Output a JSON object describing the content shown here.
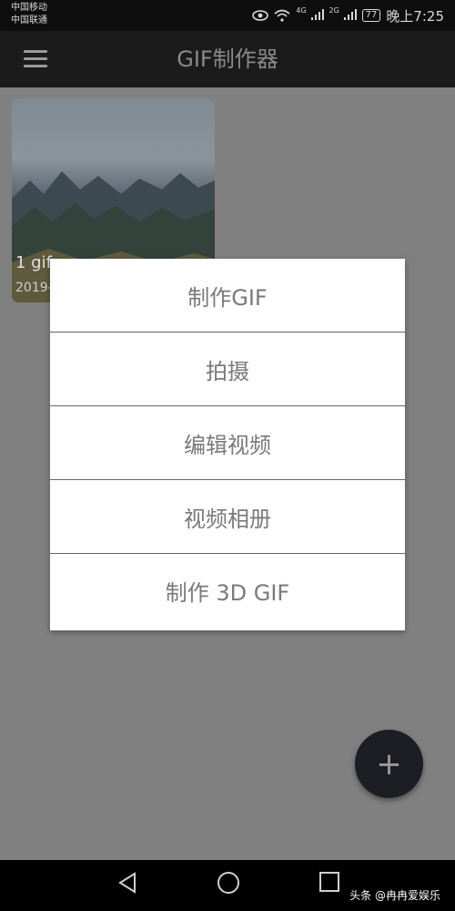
{
  "status_bar": {
    "carrier_1": "中国移动",
    "carrier_2": "中国联通",
    "network_1": "4G",
    "network_2": "2G",
    "battery": "77",
    "time": "晚上7:25"
  },
  "app_bar": {
    "title": "GIF制作器",
    "menu_icon": "hamburger-menu-icon"
  },
  "gallery": {
    "items": [
      {
        "name": "1 gif",
        "date": "2019-"
      }
    ]
  },
  "dialog": {
    "options": [
      {
        "label": "制作GIF"
      },
      {
        "label": "拍摄"
      },
      {
        "label": "编辑视频"
      },
      {
        "label": "视频相册"
      },
      {
        "label": "制作 3D GIF"
      }
    ]
  },
  "fab": {
    "icon": "plus-icon",
    "label": "+"
  },
  "nav_bar": {
    "back_icon": "back-triangle-icon",
    "home_icon": "home-circle-icon",
    "recent_icon": "recent-square-icon"
  },
  "watermark": "头条 @冉冉爱娱乐",
  "colors": {
    "scrim": "#808080",
    "app_bar": "#1b1b1b",
    "dialog_bg": "#ffffff",
    "dialog_text": "#7a7a7a",
    "fab": "#1d1d24"
  }
}
